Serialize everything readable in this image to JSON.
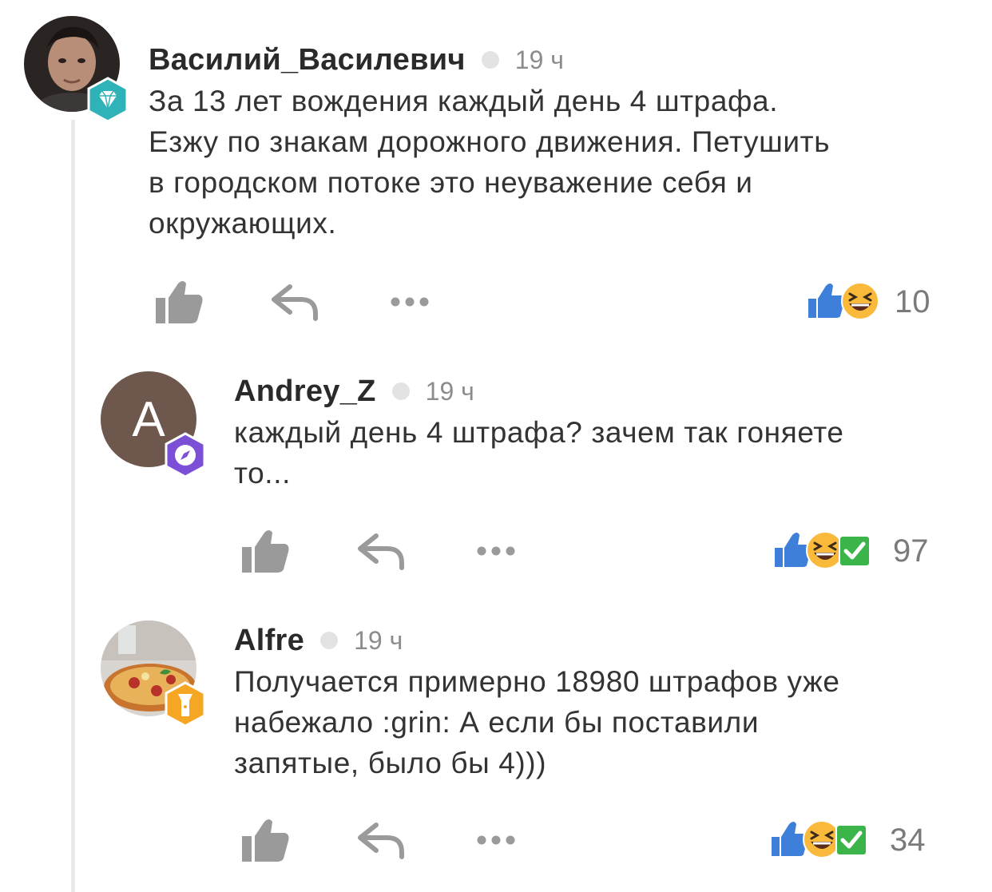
{
  "comments": [
    {
      "username": "Василий_Василевич",
      "time": "19 ч",
      "text": "За 13 лет вождения каждый день 4 штрафа.\nЕзжу по знакам дорожного движения. Петушить\nв городском потоке это неуважение себя и\nокружающих.",
      "reaction_count": "10",
      "avatar": "photo-avatar",
      "badge": "diamond-badge",
      "badge_color": "#2fb3b8",
      "reactions": [
        "like-reaction",
        "laugh-reaction"
      ]
    },
    {
      "username": "Andrey_Z",
      "time": "19 ч",
      "text": "каждый день 4 штрафа? зачем так гоняете\nто...",
      "reaction_count": "97",
      "avatar_letter": "A",
      "badge": "compass-badge",
      "badge_color": "#7b4fd6",
      "reactions": [
        "like-reaction",
        "laugh-reaction",
        "check-reaction"
      ]
    },
    {
      "username": "Alfre",
      "time": "19 ч",
      "text": "Получается примерно 18980 штрафов уже\nнабежало :grin: А если бы поставили\nзапятые, было бы 4)))",
      "reaction_count": "34",
      "avatar": "pizza-photo-avatar",
      "badge": "flashlight-badge",
      "badge_color": "#f5a623",
      "reactions": [
        "like-reaction",
        "laugh-reaction",
        "check-reaction"
      ]
    }
  ],
  "colors": {
    "like_blue": "#3d7fd9",
    "laugh_yellow": "#f9b93a",
    "check_green": "#3bb54a",
    "action_gray": "#9a9a9a"
  }
}
